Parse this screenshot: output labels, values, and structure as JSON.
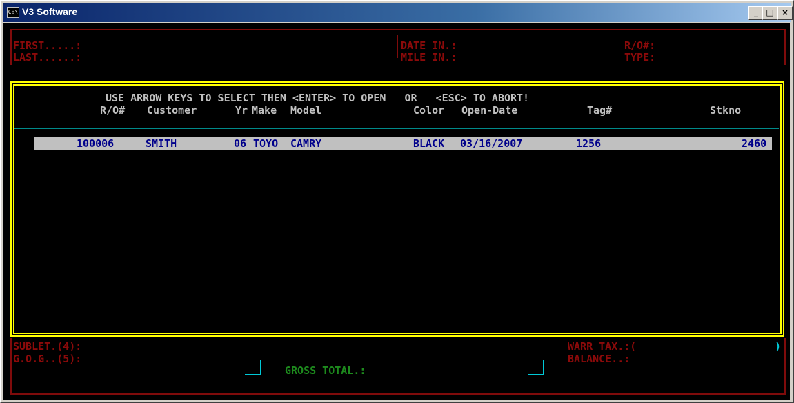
{
  "window": {
    "title": "V3 Software",
    "icon": "console-icon",
    "icon_text": "C:\\",
    "min": "_",
    "max": "□",
    "close": "×"
  },
  "top_panel": {
    "first_label": "FIRST.....:",
    "last_label": "LAST......:",
    "date_in_label": "DATE IN.:",
    "mile_in_label": "MILE IN.:",
    "ro_label": "R/O#:",
    "type_label": "TYPE:"
  },
  "list": {
    "instruction": "USE ARROW KEYS TO SELECT THEN <ENTER> TO OPEN   OR   <ESC> TO ABORT!",
    "columns": {
      "ro": "R/O#",
      "customer": "Customer",
      "yr": "Yr",
      "make": "Make",
      "model": "Model",
      "color": "Color",
      "open_date": "Open-Date",
      "tag": "Tag#",
      "stkno": "Stkno"
    },
    "rows": [
      {
        "ro": "100006",
        "customer": "SMITH",
        "yr": "06",
        "make": "TOYO",
        "model": "CAMRY",
        "color": "BLACK",
        "open_date": "03/16/2007",
        "tag": "1256",
        "stkno": "2460"
      }
    ]
  },
  "bottom_panel": {
    "sublet_label": "SUBLET.(4):",
    "gog_label": "G.O.G..(5):",
    "gross_total_label": "GROSS TOTAL.:",
    "warr_tax_label": "WARR TAX.:(",
    "warr_tax_close": ")",
    "balance_label": "BALANCE..:"
  },
  "colors": {
    "console_bg": "#000000",
    "label_green": "#1d8a1d",
    "border_red": "#7f0b0b",
    "border_yellow": "#ffff00",
    "selection_bg": "#c0c0c0",
    "selection_text": "#00008b",
    "cyan": "#00c8d6"
  }
}
